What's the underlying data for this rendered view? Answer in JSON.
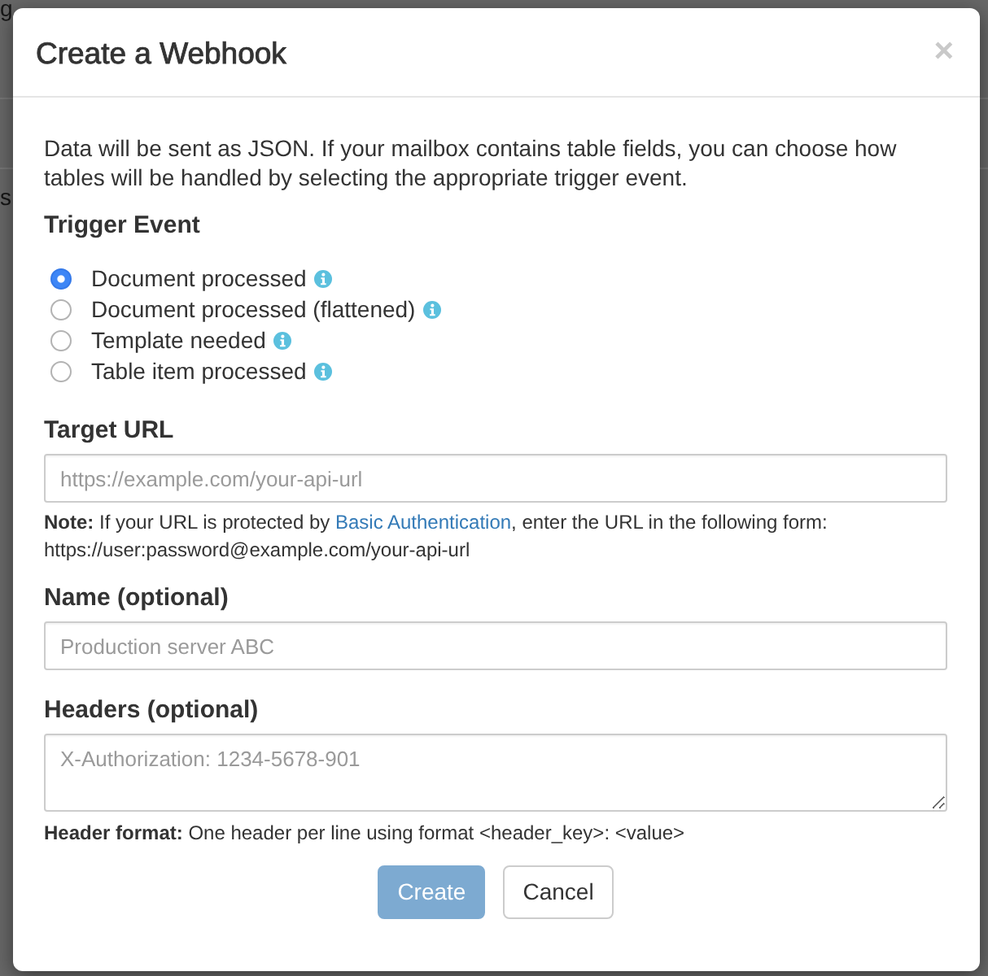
{
  "backdrop": {
    "text": "g",
    "fragment": "s"
  },
  "dialog": {
    "title": "Create a Webhook",
    "close": "×"
  },
  "intro": "Data will be sent as JSON. If your mailbox contains table fields, you can choose how tables will be handled by selecting the appropriate trigger event.",
  "trigger_event": {
    "label": "Trigger Event",
    "options": [
      {
        "label": "Document processed",
        "selected": true
      },
      {
        "label": "Document processed (flattened)",
        "selected": false
      },
      {
        "label": "Template needed",
        "selected": false
      },
      {
        "label": "Table item processed",
        "selected": false
      }
    ]
  },
  "target_url": {
    "label": "Target URL",
    "placeholder": "https://example.com/your-api-url",
    "note": {
      "before": "**Note:** If your URL is protected by ",
      "link": "Basic Authentication",
      "after": ", enter the URL in the following form: https://user:password@example.com/your-api-url"
    }
  },
  "name": {
    "label": "Name (optional)",
    "placeholder": "Production server ABC"
  },
  "headers": {
    "label": "Headers (optional)",
    "placeholder": "X-Authorization: 1234-5678-901",
    "hint": "**Header format:** One header per line using format <header_key>: <value>"
  },
  "buttons": [
    {
      "label": "Create",
      "kind": "primary",
      "disabled": true
    },
    {
      "label": "Cancel",
      "kind": "default",
      "disabled": false
    }
  ]
}
